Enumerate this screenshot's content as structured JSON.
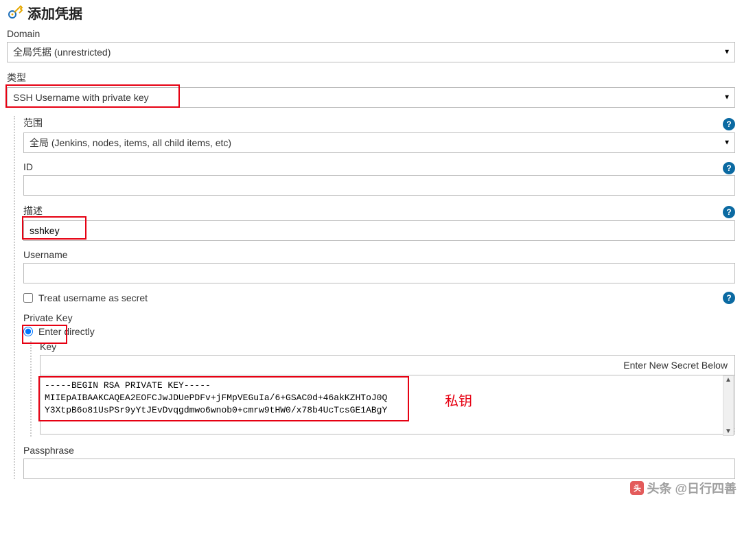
{
  "header": {
    "title": "添加凭据"
  },
  "domain": {
    "label": "Domain",
    "selected": "全局凭据 (unrestricted)"
  },
  "type": {
    "label": "类型",
    "selected": "SSH Username with private key"
  },
  "scope": {
    "label": "范围",
    "selected": "全局 (Jenkins, nodes, items, all child items, etc)"
  },
  "id": {
    "label": "ID",
    "value": ""
  },
  "description": {
    "label": "描述",
    "value": "sshkey"
  },
  "username": {
    "label": "Username",
    "value": ""
  },
  "treatSecret": {
    "label": "Treat username as secret",
    "checked": false
  },
  "privateKey": {
    "label": "Private Key",
    "enterDirectly": {
      "label": "Enter directly",
      "checked": true
    },
    "keyLabel": "Key",
    "newSecretHint": "Enter New Secret Below",
    "keyValue": "-----BEGIN RSA PRIVATE KEY-----\nMIIEpAIBAAKCAQEA2EOFCJwJDUePDFv+jFMpVEGuIa/6+GSAC0d+46akKZHToJ0Q\nY3XtpB6o81UsPSr9yYtJEvDvqgdmwo6wnob0+cmrw9tHW0/x78b4UcTcsGE1ABgY"
  },
  "passphrase": {
    "label": "Passphrase",
    "value": ""
  },
  "annotations": {
    "privateKeyNote": "私钥"
  },
  "watermark": {
    "text": "头条 @日行四善"
  }
}
